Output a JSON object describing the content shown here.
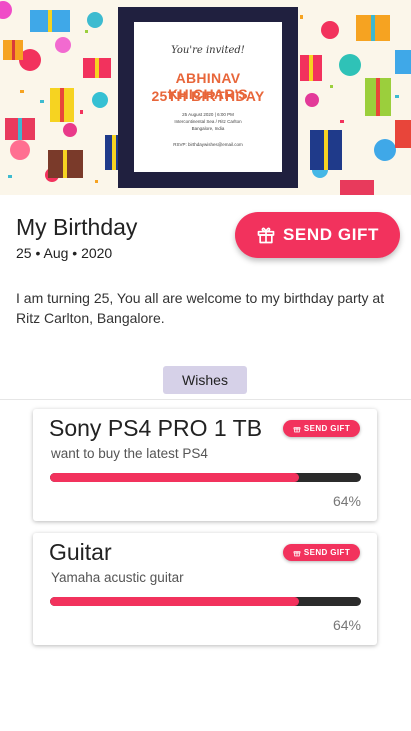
{
  "invitation": {
    "line1": "You're invited!",
    "name": "ABHINAV KHICHAR'S",
    "title": "25TH BIRTHDAY",
    "details1": "25 August 2020 | 6:00 PM",
    "details2": "Intercontinental Sea / Ritz Carlton",
    "details3": "Bangalore, India",
    "rsvp": "RSVP: birthdaywishes@email.com"
  },
  "event": {
    "title": "My Birthday",
    "date": "25 • Aug • 2020",
    "send_gift_label": "SEND GIFT",
    "description": "I am turning 25, You all are welcome to my birthday party at Ritz Carlton, Bangalore."
  },
  "wishes_label": "Wishes",
  "wishes": [
    {
      "name": "Sony PS4 PRO 1 TB",
      "description": "want to buy the latest PS4",
      "progress": 0.8,
      "percent_label": "64%",
      "button_label": "SEND GIFT"
    },
    {
      "name": "Guitar",
      "description": "Yamaha acustic guitar",
      "progress": 0.8,
      "percent_label": "64%",
      "button_label": "SEND GIFT"
    }
  ],
  "colors": {
    "accent": "#f2325d",
    "pill": "#d6d1e8",
    "frame": "#20203f",
    "invite_text": "#e8663a",
    "bar_track": "#2b2b2b"
  },
  "icons": {
    "gift": "gift-icon"
  }
}
